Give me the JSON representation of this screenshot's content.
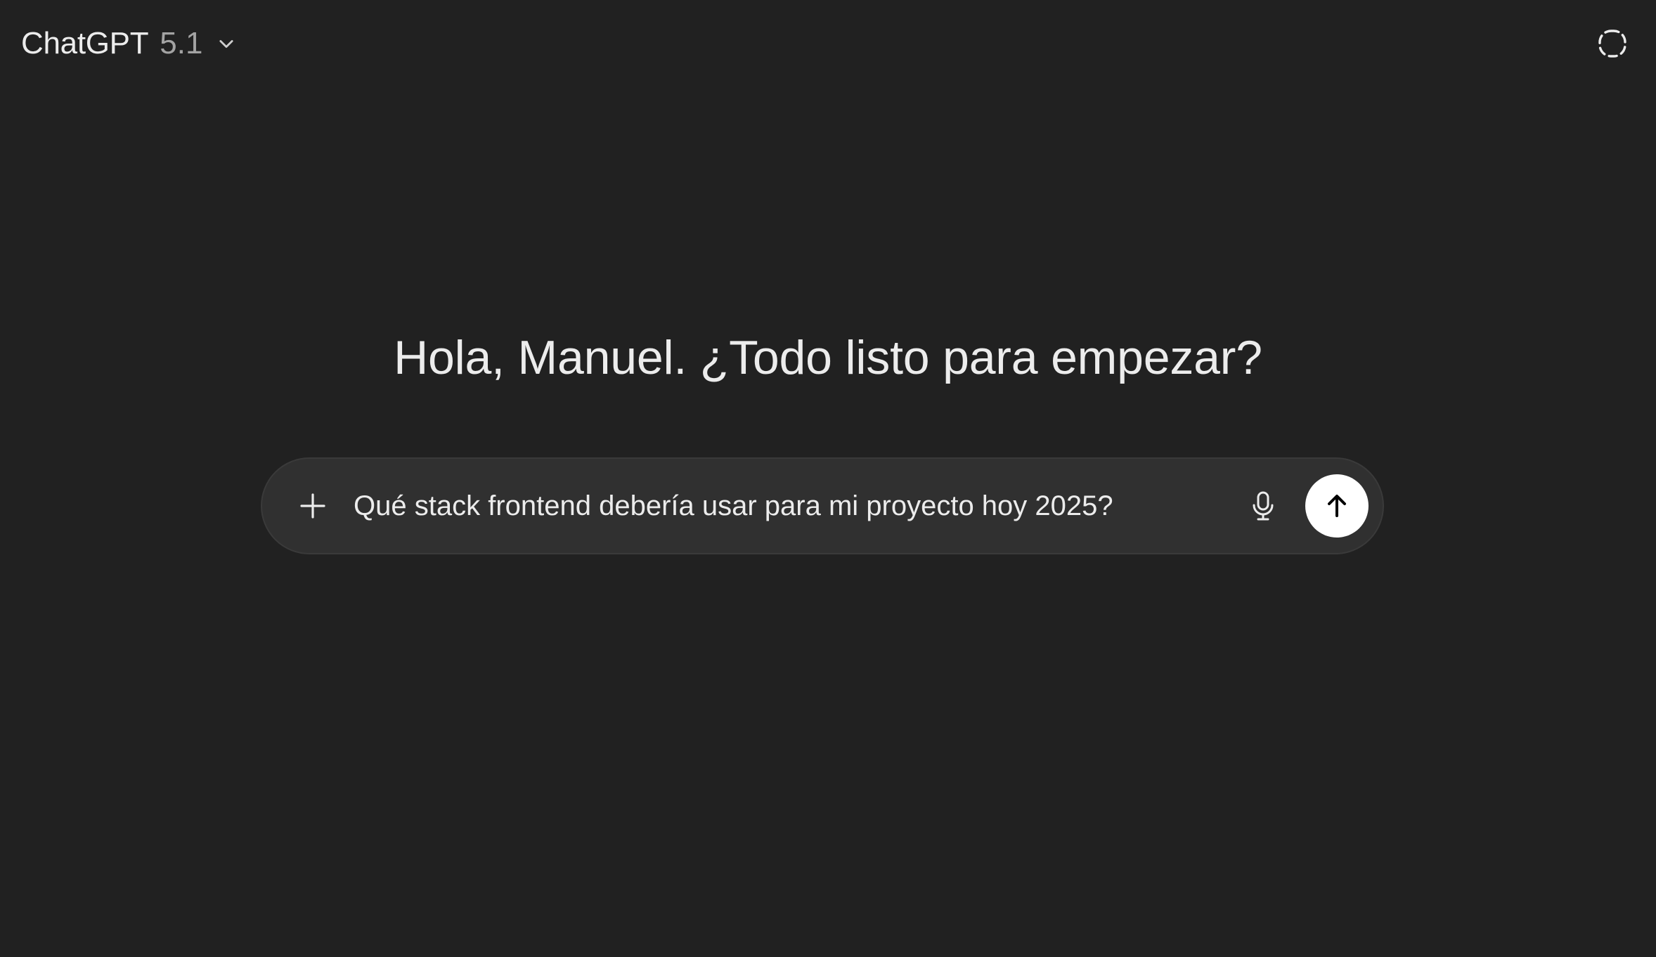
{
  "header": {
    "model_name": "ChatGPT",
    "model_version": "5.1",
    "model_dropdown_icon": "chevron-down-icon",
    "temporary_chat_icon": "dashed-circle-icon"
  },
  "main": {
    "greeting": "Hola, Manuel. ¿Todo listo para empezar?"
  },
  "composer": {
    "plus_icon": "plus-icon",
    "input_value": "Qué stack frontend debería usar para mi proyecto hoy 2025?",
    "mic_icon": "microphone-icon",
    "send_icon": "arrow-up-icon"
  },
  "colors": {
    "background": "#212121",
    "composer_background": "#303030",
    "text_primary": "#ececec",
    "text_secondary": "#a3a3a3",
    "send_button": "#ffffff"
  }
}
